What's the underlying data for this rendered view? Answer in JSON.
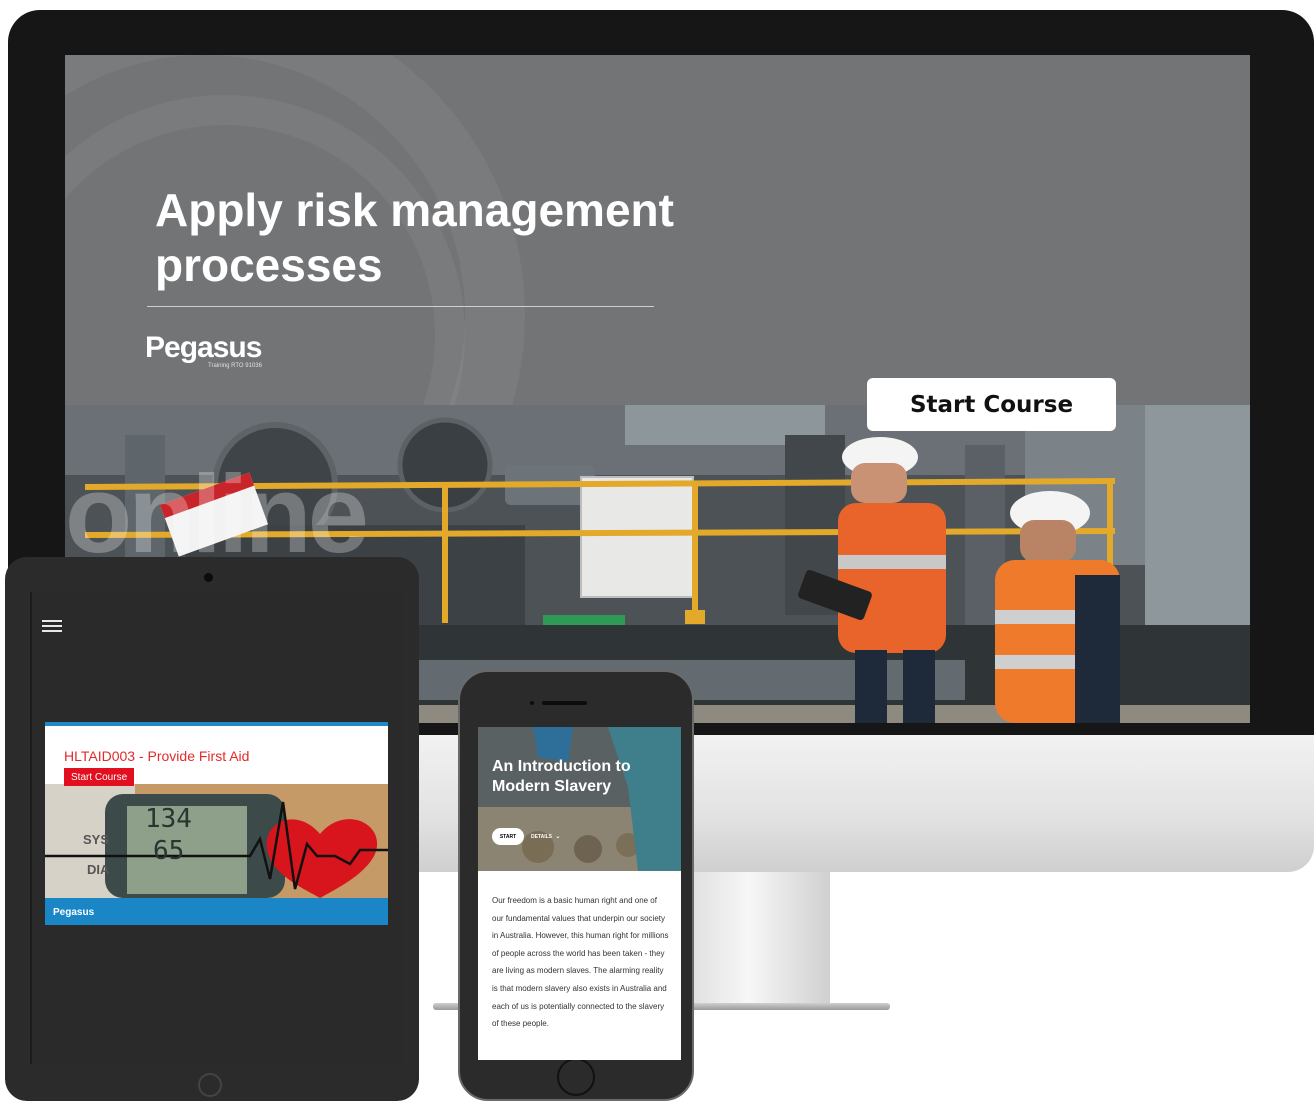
{
  "desktop": {
    "course_title": "Apply risk management processes",
    "brand_logo": "Pegasus",
    "brand_tagline": "Training RTO 91036",
    "start_button": "Start Course",
    "background_watermark": "online"
  },
  "tablet": {
    "course_title": "HLTAID003 - Provide First Aid",
    "start_button": "Start Course",
    "footer_logo": "Pegasus",
    "monitor_readings": {
      "sys_label": "SYS",
      "dia_label": "DIA",
      "sys_value": "134",
      "dia_value": "65"
    }
  },
  "phone": {
    "hero_title": "An Introduction to Modern Slavery",
    "start_button": "START",
    "details_link": "DETAILS",
    "body_text": "Our freedom is a basic human right and one of our fundamental values that underpin our society in Australia. However, this human right for millions of people across the world has been taken - they are living as modern slaves. The alarming reality is that modern slavery also exists in Australia and each of us is potentially connected to the slavery of these people."
  },
  "colors": {
    "accent_red": "#e10f1f",
    "accent_blue": "#1b86c6",
    "safety_orange": "#e8642a",
    "railing_yellow": "#e3a92a"
  }
}
